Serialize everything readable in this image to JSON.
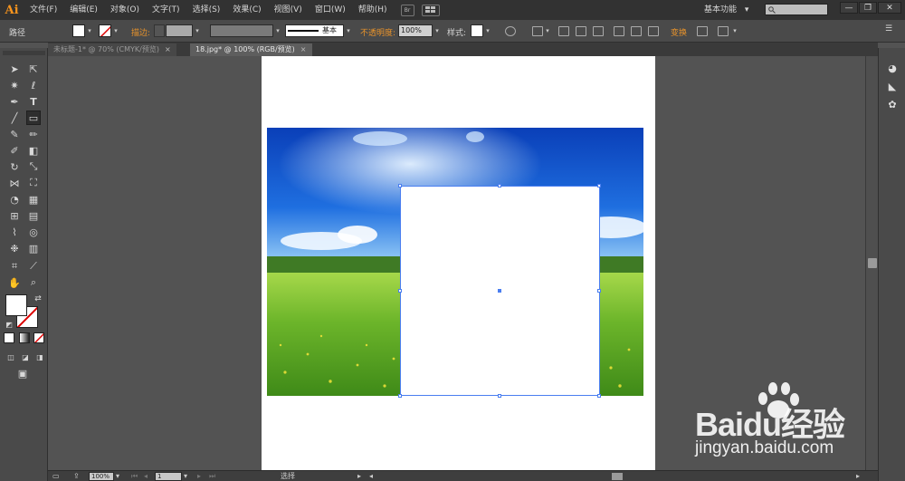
{
  "app": {
    "logo_text": "Ai"
  },
  "menu": [
    "文件(F)",
    "编辑(E)",
    "对象(O)",
    "文字(T)",
    "选择(S)",
    "效果(C)",
    "视图(V)",
    "窗口(W)",
    "帮助(H)"
  ],
  "menu_extras": {
    "bridge_label": "Br"
  },
  "workspace": {
    "label": "基本功能",
    "chevron": "▾"
  },
  "window_controls": {
    "minimize": "—",
    "restore": "❐",
    "close": "✕"
  },
  "control_bar": {
    "object_type": "路径",
    "stroke_label": "描边:",
    "stroke_profile": "基本",
    "opacity_label": "不透明度:",
    "opacity_value": "100%",
    "style_label": "样式:",
    "transform_label": "变换"
  },
  "tabs": [
    {
      "label": "未标题-1* @ 70% (CMYK/预览)",
      "active": false
    },
    {
      "label": "18.jpg* @ 100% (RGB/预览)",
      "active": true
    }
  ],
  "tab_close_glyph": "×",
  "tools": [
    "selection-tool",
    "direct-selection-tool",
    "magic-wand-tool",
    "lasso-tool",
    "pen-tool",
    "type-tool",
    "line-segment-tool",
    "rectangle-tool",
    "paintbrush-tool",
    "pencil-tool",
    "blob-brush-tool",
    "eraser-tool",
    "rotate-tool",
    "scale-tool",
    "width-tool",
    "free-transform-tool",
    "shape-builder-tool",
    "perspective-grid-tool",
    "mesh-tool",
    "gradient-tool",
    "eyedropper-tool",
    "blend-tool",
    "symbol-sprayer-tool",
    "column-graph-tool",
    "artboard-tool",
    "slice-tool",
    "hand-tool",
    "zoom-tool"
  ],
  "status_bar": {
    "zoom": "100%",
    "artboard_number": "1",
    "tool_label": "选择"
  },
  "colors": {
    "accent_orange": "#e8932b",
    "selection_blue": "#4a7ef0",
    "sky_top": "#0a3fb8",
    "grass": "#5aa61e"
  },
  "watermark": {
    "brand": "Baidu经验",
    "url": "jingyan.baidu.com"
  }
}
